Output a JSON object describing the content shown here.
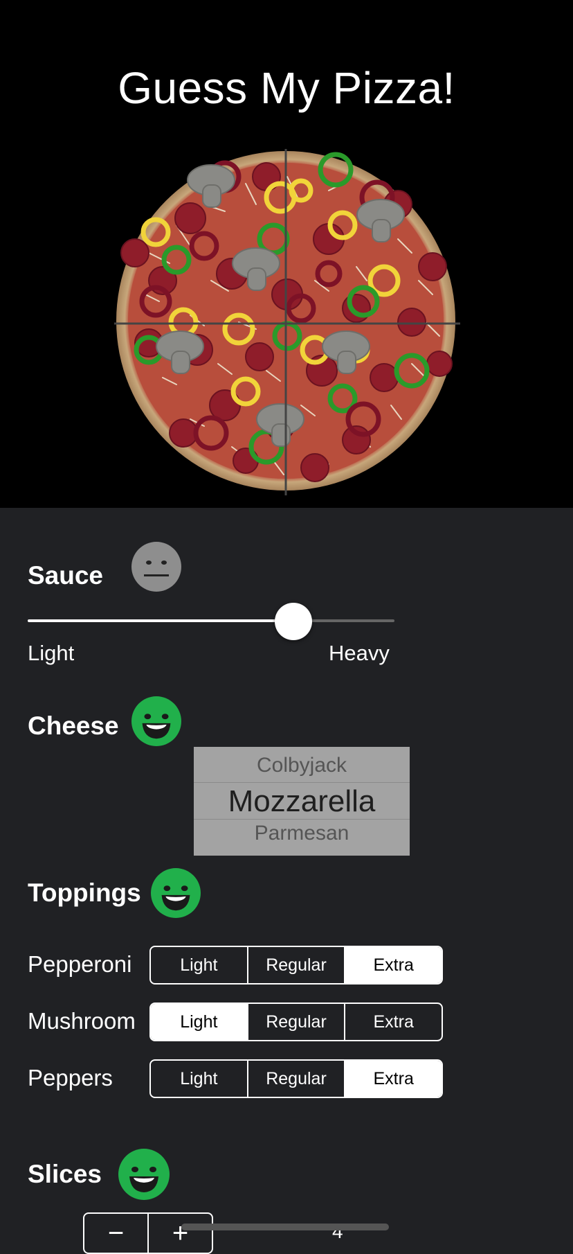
{
  "app": {
    "title": "Guess My Pizza!"
  },
  "sauce": {
    "label": "Sauce",
    "face": "neutral-face-icon",
    "slider_value": 0.75,
    "min_label": "Light",
    "max_label": "Heavy"
  },
  "cheese": {
    "label": "Cheese",
    "face": "smiley-face-icon",
    "options": [
      "Colbyjack",
      "Mozzarella",
      "Parmesan"
    ],
    "selected": "Mozzarella"
  },
  "toppings": {
    "label": "Toppings",
    "face": "smiley-face-icon",
    "rows": [
      {
        "name": "Pepperoni",
        "options": [
          "Light",
          "Regular",
          "Extra"
        ],
        "selected": "Extra"
      },
      {
        "name": "Mushroom",
        "options": [
          "Light",
          "Regular",
          "Extra"
        ],
        "selected": "Light"
      },
      {
        "name": "Peppers",
        "options": [
          "Light",
          "Regular",
          "Extra"
        ],
        "selected": "Extra"
      }
    ]
  },
  "slices": {
    "label": "Slices",
    "face": "smiley-face-icon",
    "minus": "−",
    "plus": "+",
    "value": "4"
  },
  "colors": {
    "happy": "#21b04b",
    "neutral": "#8e8e8e",
    "background": "#202124"
  }
}
